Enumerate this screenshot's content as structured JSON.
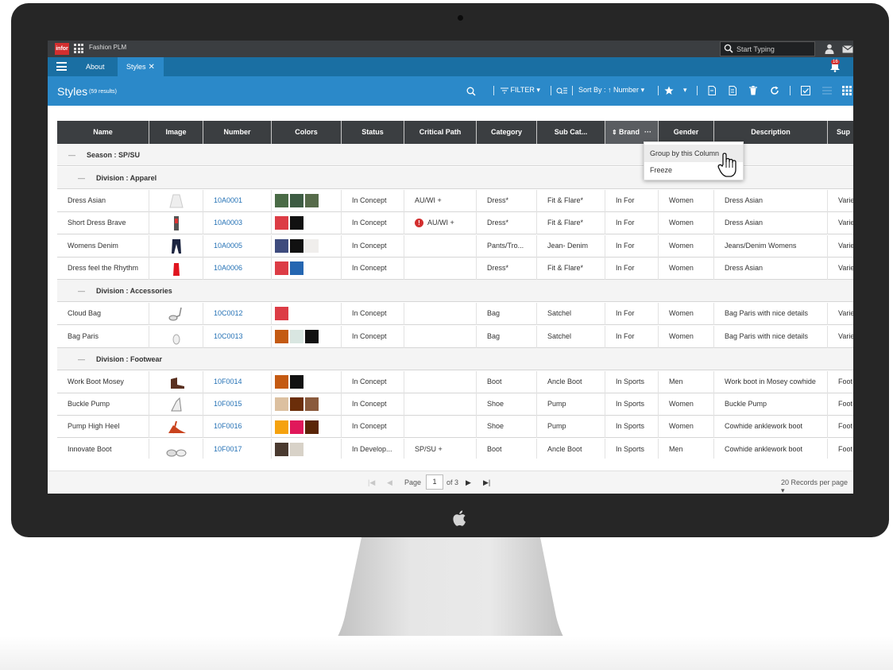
{
  "app": {
    "logo_text": "infor",
    "name": "Fashion PLM",
    "search_placeholder": "Start Typing",
    "notification_count": "16"
  },
  "tabs": {
    "about": "About",
    "styles": "Styles",
    "close": "✕"
  },
  "header": {
    "title": "Styles",
    "count": "(59 results)"
  },
  "toolbar": {
    "filter": "FILTER",
    "sort_by": "Sort By :",
    "sort_field": "Number",
    "caret": "▾"
  },
  "columns": [
    "Name",
    "Image",
    "Number",
    "Colors",
    "Status",
    "Critical Path",
    "Category",
    "Sub Cat...",
    "Brand",
    "Gender",
    "Description",
    "Sup"
  ],
  "brand_menu_dots": "···",
  "groups": {
    "season": "Season : SP/SU",
    "apparel": "Division : Apparel",
    "accessories": "Division : Accessories",
    "footwear": "Division : Footwear"
  },
  "group_dash": "—",
  "rows": [
    {
      "name": "Dress Asian",
      "number": "10A0001",
      "colors": [
        "#4a6b46",
        "#3d5c43",
        "#566b4a"
      ],
      "status": "In Concept",
      "critical": "AU/WI +",
      "critical_alert": false,
      "category": "Dress*",
      "subcat": "Fit & Flare*",
      "brand": "In For",
      "gender": "Women",
      "description": "Dress Asian",
      "sup": "Varie"
    },
    {
      "name": "Short Dress Brave",
      "number": "10A0003",
      "colors": [
        "#dc3c45",
        "#111111"
      ],
      "status": "In Concept",
      "critical": "AU/WI +",
      "critical_alert": true,
      "category": "Dress*",
      "subcat": "Fit & Flare*",
      "brand": "In For",
      "gender": "Women",
      "description": "Dress Asian",
      "sup": "Varie"
    },
    {
      "name": "Womens Denim",
      "number": "10A0005",
      "colors": [
        "#3e4b7d",
        "#111111",
        "#f0eeec"
      ],
      "status": "In Concept",
      "critical": "",
      "critical_alert": false,
      "category": "Pants/Tro...",
      "subcat": "Jean- Denim",
      "brand": "In For",
      "gender": "Women",
      "description": "Jeans/Denim Womens",
      "sup": "Varie"
    },
    {
      "name": "Dress feel the Rhythm",
      "number": "10A0006",
      "colors": [
        "#dc3c45",
        "#2566b1"
      ],
      "status": "In Concept",
      "critical": "",
      "critical_alert": false,
      "category": "Dress*",
      "subcat": "Fit & Flare*",
      "brand": "In For",
      "gender": "Women",
      "description": "Dress Asian",
      "sup": "Varie"
    },
    {
      "name": "Cloud Bag",
      "number": "10C0012",
      "colors": [
        "#dc3c45"
      ],
      "status": "In Concept",
      "critical": "",
      "critical_alert": false,
      "category": "Bag",
      "subcat": "Satchel",
      "brand": "In For",
      "gender": "Women",
      "description": "Bag Paris with nice details",
      "sup": "Varie"
    },
    {
      "name": "Bag Paris",
      "number": "10C0013",
      "colors": [
        "#c45a12",
        "#d9e6e1",
        "#111111"
      ],
      "status": "In Concept",
      "critical": "",
      "critical_alert": false,
      "category": "Bag",
      "subcat": "Satchel",
      "brand": "In For",
      "gender": "Women",
      "description": "Bag Paris with nice details",
      "sup": "Varie"
    },
    {
      "name": "Work Boot Mosey",
      "number": "10F0014",
      "colors": [
        "#c45a12",
        "#111111"
      ],
      "status": "In Concept",
      "critical": "",
      "critical_alert": false,
      "category": "Boot",
      "subcat": "Ancle Boot",
      "brand": "In Sports",
      "gender": "Men",
      "description": "Work boot in Mosey cowhide",
      "sup": "Foot"
    },
    {
      "name": "Buckle Pump",
      "number": "10F0015",
      "colors": [
        "#dcc0a0",
        "#6b2e0a",
        "#8a5a3c"
      ],
      "status": "In Concept",
      "critical": "",
      "critical_alert": false,
      "category": "Shoe",
      "subcat": "Pump",
      "brand": "In Sports",
      "gender": "Women",
      "description": "Buckle Pump",
      "sup": "Foot"
    },
    {
      "name": "Pump High Heel",
      "number": "10F0016",
      "colors": [
        "#f5a20e",
        "#e0185a",
        "#5a2507"
      ],
      "status": "In Concept",
      "critical": "",
      "critical_alert": false,
      "category": "Shoe",
      "subcat": "Pump",
      "brand": "In Sports",
      "gender": "Women",
      "description": "Cowhide anklework boot",
      "sup": "Foot"
    },
    {
      "name": "Innovate Boot",
      "number": "10F0017",
      "colors": [
        "#4a3a30",
        "#d8d2c8"
      ],
      "status": "In Develop...",
      "critical": "SP/SU +",
      "critical_alert": false,
      "category": "Boot",
      "subcat": "Ancle Boot",
      "brand": "In Sports",
      "gender": "Men",
      "description": "Cowhide anklework boot",
      "sup": "Foot"
    }
  ],
  "context_menu": {
    "group_by": "Group by this Column",
    "freeze": "Freeze"
  },
  "pager": {
    "page_label": "Page",
    "page_value": "1",
    "of": "of 3",
    "records": "20 Records per page"
  },
  "icons": [
    "search-icon",
    "filter-icon",
    "sort-arrow-icon",
    "star-icon",
    "trash-icon",
    "refresh-icon",
    "apps-grid-icon",
    "user-icon",
    "mail-icon",
    "bell-icon",
    "hand-pointer-icon"
  ]
}
